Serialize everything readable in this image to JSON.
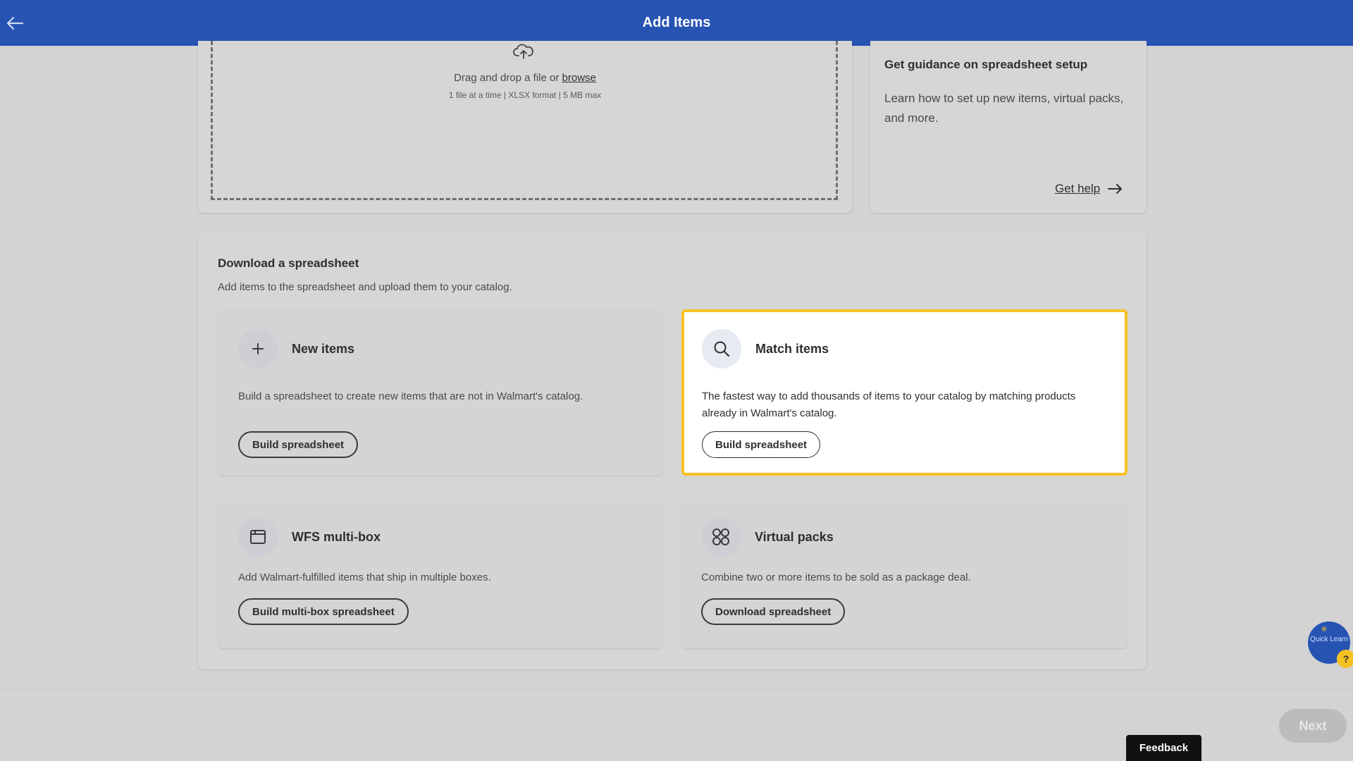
{
  "header": {
    "title": "Add Items",
    "back_icon": "arrow-left-icon"
  },
  "upload": {
    "icon": "cloud-upload-icon",
    "drop_text": "Drag and drop a file or",
    "browse_label": "browse",
    "constraints": "1 file at a time | XLSX format | 5 MB max"
  },
  "help": {
    "title": "Get guidance on spreadsheet setup",
    "description": "Learn how to set up new items, virtual packs, and more.",
    "link_label": "Get help",
    "link_icon": "arrow-right-icon"
  },
  "download": {
    "title": "Download a spreadsheet",
    "description": "Add items to the spreadsheet and upload them to your catalog.",
    "options": {
      "new_items": {
        "icon": "plus-icon",
        "title": "New items",
        "description": "Build a spreadsheet to create new items that are not in Walmart's catalog.",
        "button": "Build spreadsheet"
      },
      "match_items": {
        "icon": "search-icon",
        "title": "Match items",
        "description": "The fastest way to add thousands of items to your catalog by matching products already in Walmart's catalog.",
        "button": "Build spreadsheet"
      },
      "wfs_multibox": {
        "icon": "box-icon",
        "title": "WFS multi-box",
        "description": "Add Walmart-fulfilled items that ship in multiple boxes.",
        "button": "Build multi-box spreadsheet"
      },
      "virtual_packs": {
        "icon": "grid-circles-icon",
        "title": "Virtual packs",
        "description": "Combine two or more items to be sold as a package deal.",
        "button": "Download spreadsheet"
      }
    }
  },
  "footer": {
    "next_label": "Next",
    "feedback_label": "Feedback"
  },
  "quick_learn": {
    "label": "Quick Learn",
    "badge": "?"
  },
  "colors": {
    "header": "#2753b3",
    "highlight": "#f6c122",
    "dim_bg": "#d3d3d3"
  }
}
